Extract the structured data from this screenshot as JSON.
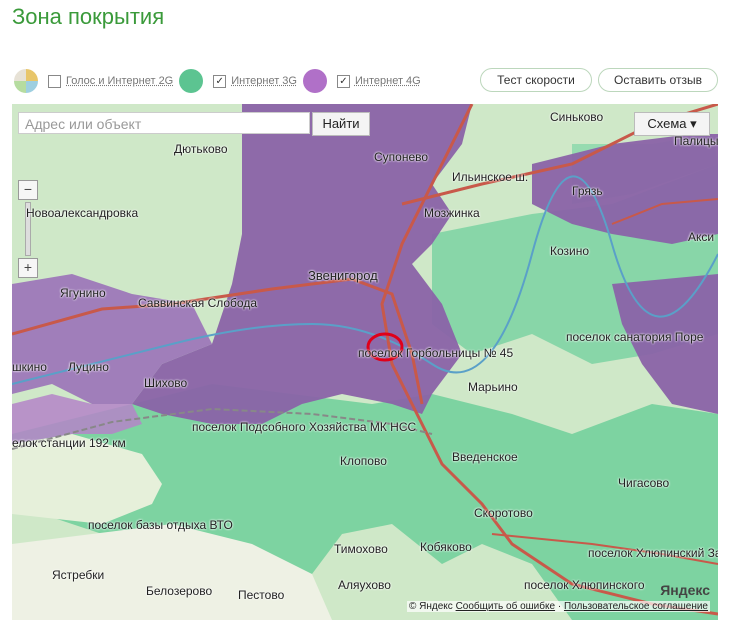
{
  "page": {
    "title": "Зона покрытия"
  },
  "legend": {
    "items": [
      {
        "label": "Голос и Интернет 2G",
        "checked": false,
        "color": "#e8c66a"
      },
      {
        "label": "Интернет 3G",
        "checked": true,
        "color": "#5cc491"
      },
      {
        "label": "Интернет 4G",
        "checked": true,
        "color": "#b070c8"
      }
    ],
    "checkmark": "✓"
  },
  "buttons": {
    "speed_test": "Тест скорости",
    "feedback": "Оставить отзыв"
  },
  "map": {
    "search_placeholder": "Адрес или объект",
    "find_button": "Найти",
    "scheme_button": "Схема ▾",
    "zoom_in": "+",
    "zoom_out": "−",
    "colors": {
      "coverage_4g": "#8a63a8",
      "coverage_3g": "#6fcf9a",
      "base": "#cfe8c8",
      "road": "#c8594a",
      "marker": "#e0001a"
    },
    "places": {
      "dyutkovo": "Дютьково",
      "novoaleksandrovka": "Новоалександровка",
      "supoenevo": "Супонево",
      "ilinskoe": "Ильинское ш.",
      "sinkovo": "Синьково",
      "palitsy": "Палицы",
      "gryaz": "Грязь",
      "mozhzhinka": "Мозжинка",
      "aksi": "Акси",
      "kozino": "Козино",
      "zvenigorod": "Звенигород",
      "yagunino": "Ягунино",
      "savvinskaya": "Саввинская Слобода",
      "sanatorium": "поселок санатория Поре",
      "gorbolnitsy": "поселок Горбольницы № 45",
      "shkino": "шкино",
      "lutsino": "Луцино",
      "shikhovo": "Шихово",
      "maryino": "Марьино",
      "station": "елок станции 192 км",
      "podsobnoe": "поселок Подсобного Хозяйства МК НСС",
      "klopovo": "Клопово",
      "vvedenskoe": "Введенское",
      "chigasovo": "Чигасово",
      "vto": "поселок базы отдыха ВТО",
      "skorotovo": "Скоротово",
      "timokhovo": "Тимохово",
      "kobyakovo": "Кобяково",
      "khlyupino_za": "поселок Хлюпинский За",
      "yastrebki": "Ястребки",
      "alyaukhovo": "Аляухово",
      "khlyupino2": "поселок Хлюпинского",
      "belozerovo": "Белозерово",
      "pestovo": "Пестово"
    },
    "footer": {
      "copyright": "© Яндекс",
      "report": "Сообщить об ошибке",
      "separator": "·",
      "agreement": "Пользовательское соглашение"
    },
    "logo": "Яндекс"
  }
}
